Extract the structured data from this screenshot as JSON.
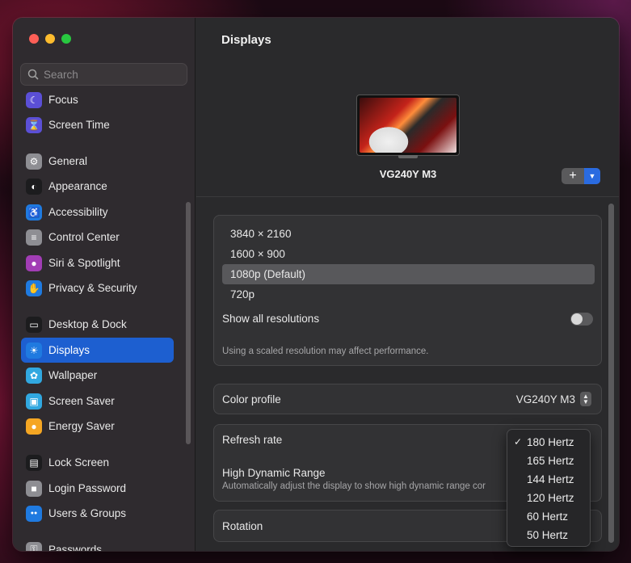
{
  "search": {
    "placeholder": "Search"
  },
  "sidebar": {
    "items": [
      {
        "label": "Focus",
        "icon": "moon-icon",
        "color": "#5b4fd6"
      },
      {
        "label": "Screen Time",
        "icon": "hourglass-icon",
        "color": "#5b4fd6"
      },
      {
        "label": "General",
        "icon": "gear-icon",
        "color": "#8e8e93"
      },
      {
        "label": "Appearance",
        "icon": "appearance-icon",
        "color": "#1c1c1e"
      },
      {
        "label": "Accessibility",
        "icon": "accessibility-icon",
        "color": "#1f7ae0"
      },
      {
        "label": "Control Center",
        "icon": "toggles-icon",
        "color": "#8e8e93"
      },
      {
        "label": "Siri & Spotlight",
        "icon": "siri-icon",
        "color": "#a23db5"
      },
      {
        "label": "Privacy & Security",
        "icon": "hand-icon",
        "color": "#1f7ae0"
      },
      {
        "label": "Desktop & Dock",
        "icon": "dock-icon",
        "color": "#1c1c1e"
      },
      {
        "label": "Displays",
        "icon": "sun-icon",
        "color": "#1f7ae0"
      },
      {
        "label": "Wallpaper",
        "icon": "flower-icon",
        "color": "#31a8e0"
      },
      {
        "label": "Screen Saver",
        "icon": "screensaver-icon",
        "color": "#31a8e0"
      },
      {
        "label": "Energy Saver",
        "icon": "bulb-icon",
        "color": "#f5a623"
      },
      {
        "label": "Lock Screen",
        "icon": "lock-screen-icon",
        "color": "#1c1c1e"
      },
      {
        "label": "Login Password",
        "icon": "lock-icon",
        "color": "#8e8e93"
      },
      {
        "label": "Users & Groups",
        "icon": "users-icon",
        "color": "#1f7ae0"
      },
      {
        "label": "Passwords",
        "icon": "key-icon",
        "color": "#8e8e93"
      }
    ],
    "active": "Displays"
  },
  "main": {
    "title": "Displays",
    "monitor_name": "VG240Y M3",
    "add_button": "+",
    "resolutions": [
      "3840 × 2160",
      "1600 × 900",
      "1080p (Default)",
      "720p"
    ],
    "selected_resolution": "1080p (Default)",
    "show_all_resolutions_label": "Show all resolutions",
    "show_all_resolutions_on": false,
    "scaled_note": "Using a scaled resolution may affect performance.",
    "color_profile_label": "Color profile",
    "color_profile_value": "VG240Y M3",
    "refresh_rate_label": "Refresh rate",
    "hdr_label": "High Dynamic Range",
    "hdr_desc": "Automatically adjust the display to show high dynamic range cor",
    "rotation_label": "Rotation"
  },
  "refresh_menu": {
    "items": [
      "180 Hertz",
      "165 Hertz",
      "144 Hertz",
      "120 Hertz",
      "60 Hertz",
      "50 Hertz"
    ],
    "selected": "180 Hertz",
    "check_glyph": "✓"
  }
}
